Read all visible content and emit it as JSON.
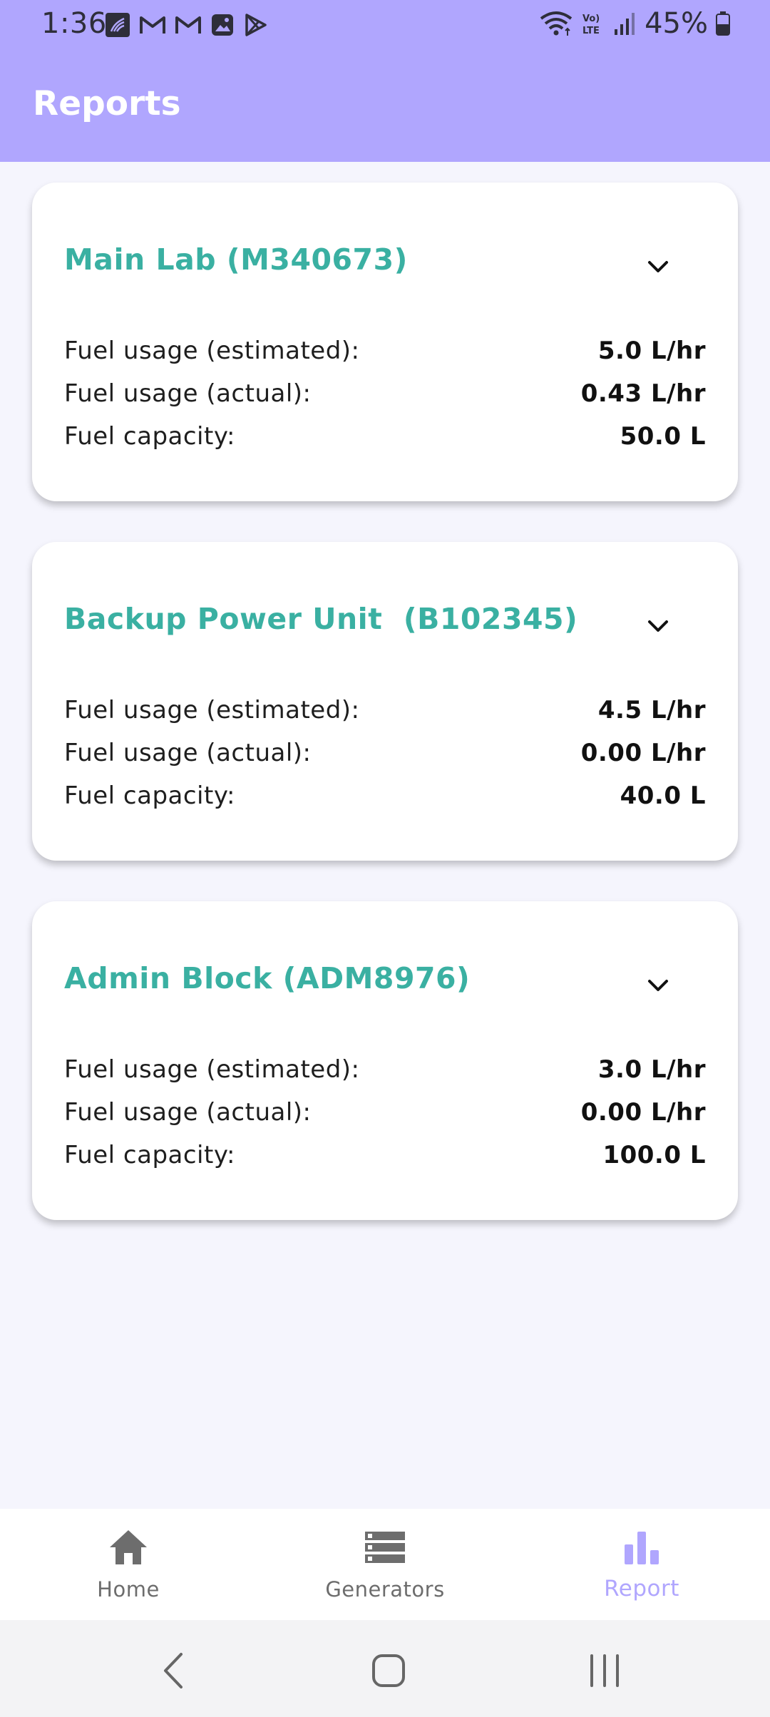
{
  "status_bar": {
    "time": "1:36",
    "battery": "45%",
    "left_icons": [
      "notification-icon",
      "gmail-icon",
      "gmail-icon",
      "gallery-icon",
      "play-store-icon"
    ],
    "right_icons": [
      "wifi-icon",
      "volte-icon",
      "signal-icon",
      "battery-icon"
    ]
  },
  "app_bar": {
    "title": "Reports"
  },
  "colors": {
    "header": "#b0a6fe",
    "accent_title": "#3ab0a2",
    "active_nav": "#b0a6fe",
    "inactive_nav": "#6d6d6d"
  },
  "cards": [
    {
      "title": "Main Lab (M340673)",
      "rows": [
        {
          "label": "Fuel usage (estimated):",
          "value": "5.0 L/hr"
        },
        {
          "label": "Fuel usage (actual):",
          "value": "0.43 L/hr"
        },
        {
          "label": "Fuel capacity:",
          "value": "50.0 L"
        }
      ]
    },
    {
      "title": "Backup Power Unit  (B102345)",
      "rows": [
        {
          "label": "Fuel usage (estimated):",
          "value": "4.5 L/hr"
        },
        {
          "label": "Fuel usage (actual):",
          "value": "0.00 L/hr"
        },
        {
          "label": "Fuel capacity:",
          "value": "40.0 L"
        }
      ]
    },
    {
      "title": "Admin Block (ADM8976)",
      "rows": [
        {
          "label": "Fuel usage (estimated):",
          "value": "3.0 L/hr"
        },
        {
          "label": "Fuel usage (actual):",
          "value": "0.00 L/hr"
        },
        {
          "label": "Fuel capacity:",
          "value": "100.0 L"
        }
      ]
    }
  ],
  "bottom_nav": {
    "items": [
      {
        "label": "Home",
        "icon": "home-icon",
        "active": false
      },
      {
        "label": "Generators",
        "icon": "list-icon",
        "active": false
      },
      {
        "label": "Report",
        "icon": "bar-chart-icon",
        "active": true
      }
    ]
  },
  "system_nav": [
    "back-icon",
    "home-circle-icon",
    "recents-icon"
  ]
}
